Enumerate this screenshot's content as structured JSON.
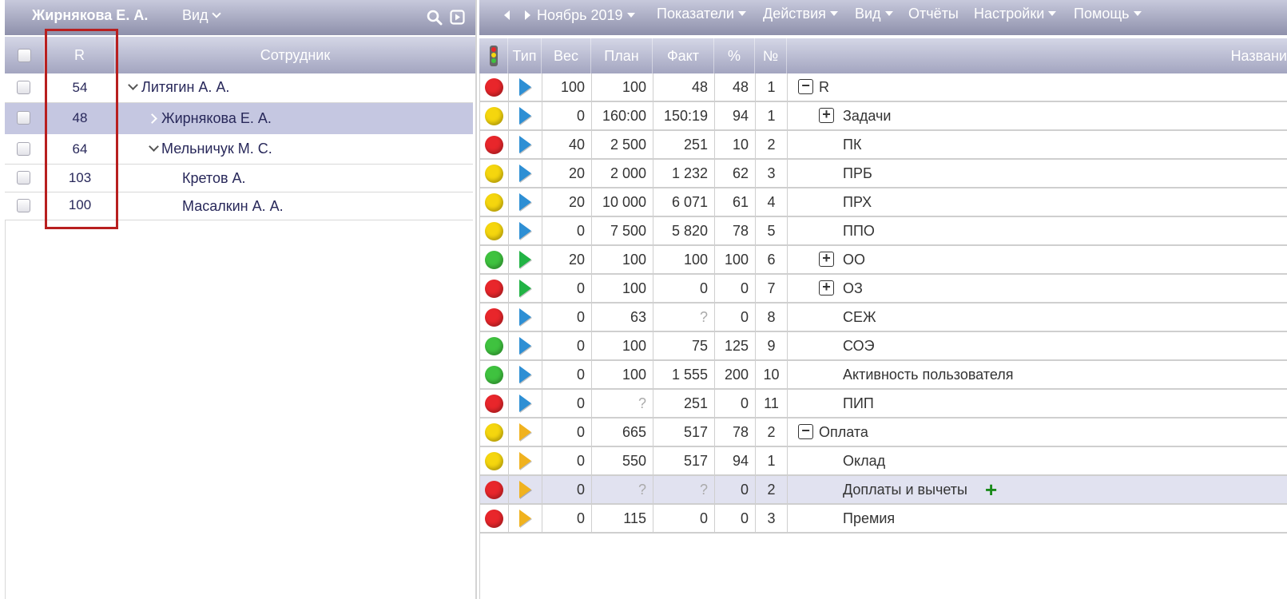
{
  "left_panel": {
    "title": "Жирнякова Е. А.",
    "view_menu": "Вид",
    "columns": {
      "r": "R",
      "employee": "Сотрудник"
    },
    "rows": [
      {
        "r": "54",
        "name": "Литягин А. А."
      },
      {
        "r": "48",
        "name": "Жирнякова Е. А."
      },
      {
        "r": "64",
        "name": "Мельничук М. С."
      },
      {
        "r": "103",
        "name": "Кретов А."
      },
      {
        "r": "100",
        "name": "Масалкин А. А."
      }
    ]
  },
  "right_panel": {
    "period": "Ноябрь 2019",
    "menu": {
      "indicators": "Показатели",
      "actions": "Действия",
      "view": "Вид",
      "reports": "Отчёты",
      "settings": "Настройки",
      "help": "Помощь"
    },
    "columns": {
      "type": "Тип",
      "weight": "Вес",
      "plan": "План",
      "fact": "Факт",
      "percent": "%",
      "number": "№",
      "name": "Названи"
    },
    "rows": [
      {
        "status": "red",
        "type": "blue",
        "weight": "100",
        "plan": "100",
        "fact": "48",
        "percent": "48",
        "number": "1",
        "name": "R"
      },
      {
        "status": "yellow",
        "type": "blue",
        "weight": "0",
        "plan": "160:00",
        "fact": "150:19",
        "percent": "94",
        "number": "1",
        "name": "Задачи"
      },
      {
        "status": "red",
        "type": "blue",
        "weight": "40",
        "plan": "2 500",
        "fact": "251",
        "percent": "10",
        "number": "2",
        "name": "ПК"
      },
      {
        "status": "yellow",
        "type": "blue",
        "weight": "20",
        "plan": "2 000",
        "fact": "1 232",
        "percent": "62",
        "number": "3",
        "name": "ПРБ"
      },
      {
        "status": "yellow",
        "type": "blue",
        "weight": "20",
        "plan": "10 000",
        "fact": "6 071",
        "percent": "61",
        "number": "4",
        "name": "ПРХ"
      },
      {
        "status": "yellow",
        "type": "blue",
        "weight": "0",
        "plan": "7 500",
        "fact": "5 820",
        "percent": "78",
        "number": "5",
        "name": "ППО"
      },
      {
        "status": "green",
        "type": "green",
        "weight": "20",
        "plan": "100",
        "fact": "100",
        "percent": "100",
        "number": "6",
        "name": "ОО"
      },
      {
        "status": "red",
        "type": "green",
        "weight": "0",
        "plan": "100",
        "fact": "0",
        "percent": "0",
        "number": "7",
        "name": "ОЗ"
      },
      {
        "status": "red",
        "type": "blue",
        "weight": "0",
        "plan": "63",
        "fact": "?",
        "percent": "0",
        "number": "8",
        "name": "СЕЖ"
      },
      {
        "status": "green",
        "type": "blue",
        "weight": "0",
        "plan": "100",
        "fact": "75",
        "percent": "125",
        "number": "9",
        "name": "СОЭ"
      },
      {
        "status": "green",
        "type": "blue",
        "weight": "0",
        "plan": "100",
        "fact": "1 555",
        "percent": "200",
        "number": "10",
        "name": "Активность пользователя"
      },
      {
        "status": "red",
        "type": "blue",
        "weight": "0",
        "plan": "?",
        "fact": "251",
        "percent": "0",
        "number": "11",
        "name": "ПИП"
      },
      {
        "status": "yellow",
        "type": "yellow",
        "weight": "0",
        "plan": "665",
        "fact": "517",
        "percent": "78",
        "number": "2",
        "name": "Оплата"
      },
      {
        "status": "yellow",
        "type": "yellow",
        "weight": "0",
        "plan": "550",
        "fact": "517",
        "percent": "94",
        "number": "1",
        "name": "Оклад"
      },
      {
        "status": "red",
        "type": "yellow",
        "weight": "0",
        "plan": "?",
        "fact": "?",
        "percent": "0",
        "number": "2",
        "name": "Доплаты и вычеты"
      },
      {
        "status": "red",
        "type": "yellow",
        "weight": "0",
        "plan": "115",
        "fact": "0",
        "percent": "0",
        "number": "3",
        "name": "Премия"
      }
    ]
  },
  "colors": {
    "status_red": "#e8262b",
    "status_yellow": "#f5d60e",
    "status_green": "#3fc23f",
    "type_blue": "#2e8fd4",
    "type_green": "#22b345",
    "type_yellow": "#f0b21f",
    "selection": "#c5c7e1",
    "highlight_frame": "#b81f1f"
  }
}
